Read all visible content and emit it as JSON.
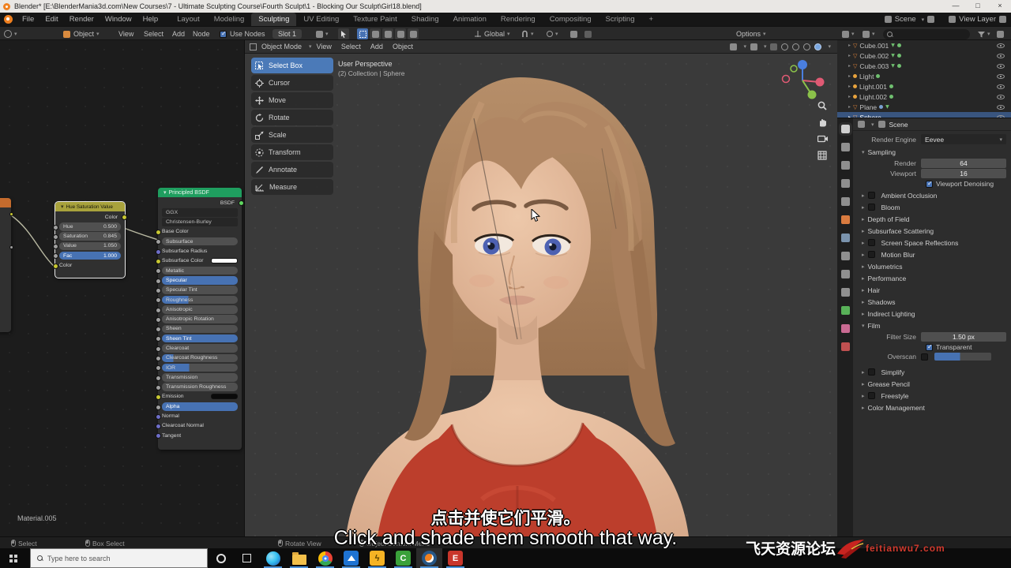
{
  "window": {
    "title": "Blender* [E:\\BlenderMania3d.com\\New Courses\\7 - Ultimate Sculpting Course\\Fourth Sculpt\\1 - Blocking Our Sculpt\\Girl18.blend]",
    "minimize": "—",
    "maximize": "□",
    "close": "×"
  },
  "topbar": {
    "menus": [
      "File",
      "Edit",
      "Render",
      "Window",
      "Help"
    ],
    "tabs": [
      "Layout",
      "Modeling",
      "Sculpting",
      "UV Editing",
      "Texture Paint",
      "Shading",
      "Animation",
      "Rendering",
      "Compositing",
      "Scripting",
      "+"
    ],
    "active_tab": "Sculpting",
    "scene": "Scene",
    "view_layer": "View Layer"
  },
  "tool_settings": {
    "object": "Object",
    "menus": [
      "View",
      "Select",
      "Add",
      "Node"
    ],
    "use_nodes": "Use Nodes",
    "slot": "Slot 1",
    "orientation": "Global",
    "options": "Options"
  },
  "shader_editor": {
    "material_name": "Material.005",
    "hsv": {
      "title": "Hue Saturation Value",
      "output": "Color",
      "fields": [
        {
          "label": "Hue",
          "value": "0.500"
        },
        {
          "label": "Saturation",
          "value": "0.845"
        },
        {
          "label": "Value",
          "value": "1.050"
        },
        {
          "label": "Fac",
          "value": "1.000"
        }
      ],
      "input": "Color"
    },
    "principled": {
      "title": "Principled BSDF",
      "output": "BSDF",
      "distribution": "GGX",
      "sss_method": "Christensen-Burley",
      "rows": [
        {
          "label": "Base Color"
        },
        {
          "label": "Subsurface"
        },
        {
          "label": "Subsurface Radius"
        },
        {
          "label": "Subsurface Color"
        },
        {
          "label": "Metallic"
        },
        {
          "label": "Specular"
        },
        {
          "label": "Specular Tint"
        },
        {
          "label": "Roughness"
        },
        {
          "label": "Anisotropic"
        },
        {
          "label": "Anisotropic Rotation"
        },
        {
          "label": "Sheen"
        },
        {
          "label": "Sheen Tint"
        },
        {
          "label": "Clearcoat"
        },
        {
          "label": "Clearcoat Roughness"
        },
        {
          "label": "IOR"
        },
        {
          "label": "Transmission"
        },
        {
          "label": "Transmission Roughness"
        },
        {
          "label": "Emission"
        },
        {
          "label": "Alpha"
        },
        {
          "label": "Normal"
        },
        {
          "label": "Clearcoat Normal"
        },
        {
          "label": "Tangent"
        }
      ]
    }
  },
  "viewport": {
    "mode": "Object Mode",
    "menus": [
      "View",
      "Select",
      "Add",
      "Object"
    ],
    "overlay_line1": "User Perspective",
    "overlay_line2": "(2) Collection | Sphere",
    "tools": [
      {
        "label": "Select Box"
      },
      {
        "label": "Cursor"
      },
      {
        "label": "Move"
      },
      {
        "label": "Rotate"
      },
      {
        "label": "Scale"
      },
      {
        "label": "Transform"
      },
      {
        "label": "Annotate"
      },
      {
        "label": "Measure"
      }
    ],
    "active_tool": "Select Box"
  },
  "outliner": {
    "items": [
      {
        "name": "Cube.001"
      },
      {
        "name": "Cube.002"
      },
      {
        "name": "Cube.003"
      },
      {
        "name": "Light"
      },
      {
        "name": "Light.001"
      },
      {
        "name": "Light.002"
      },
      {
        "name": "Plane"
      },
      {
        "name": "Sphere"
      }
    ],
    "selected": "Sphere"
  },
  "properties": {
    "breadcrumb": "Scene",
    "render_engine_label": "Render Engine",
    "render_engine": "Eevee",
    "sampling": {
      "title": "Sampling",
      "render_label": "Render",
      "render": "64",
      "viewport_label": "Viewport",
      "viewport": "16",
      "denoising": "Viewport Denoising"
    },
    "sections": [
      {
        "label": "Ambient Occlusion"
      },
      {
        "label": "Bloom"
      },
      {
        "label": "Depth of Field"
      },
      {
        "label": "Subsurface Scattering"
      },
      {
        "label": "Screen Space Reflections"
      },
      {
        "label": "Motion Blur"
      },
      {
        "label": "Volumetrics"
      },
      {
        "label": "Performance"
      },
      {
        "label": "Hair"
      },
      {
        "label": "Shadows"
      },
      {
        "label": "Indirect Lighting"
      }
    ],
    "film": {
      "title": "Film",
      "filter_size_label": "Filter Size",
      "filter_size": "1.50 px",
      "transparent": "Transparent",
      "overscan_label": "Overscan"
    },
    "sections2": [
      {
        "label": "Simplify"
      },
      {
        "label": "Grease Pencil"
      },
      {
        "label": "Freestyle"
      },
      {
        "label": "Color Management"
      }
    ]
  },
  "subtitles": {
    "zh": "点击并使它们平滑。",
    "en": "Click and shade them smooth that way."
  },
  "status_bar": {
    "items": [
      "Select",
      "Box Select",
      "Rotate View",
      "Object Context Menu"
    ]
  },
  "taskbar": {
    "search_placeholder": "Type here to search",
    "apps": [
      "cortana",
      "task-view",
      "edge",
      "file-explorer",
      "chrome",
      "photos",
      "capture-app",
      "camtasia",
      "blender",
      "video-editor"
    ]
  },
  "watermark": {
    "site": "飞天资源论坛",
    "url": "feitianwu7.com"
  },
  "colors": {
    "accent": "#4772b3",
    "shader_header": "#1f9e5f",
    "color_node_header": "#a8a23c",
    "selection": "#39557f"
  }
}
